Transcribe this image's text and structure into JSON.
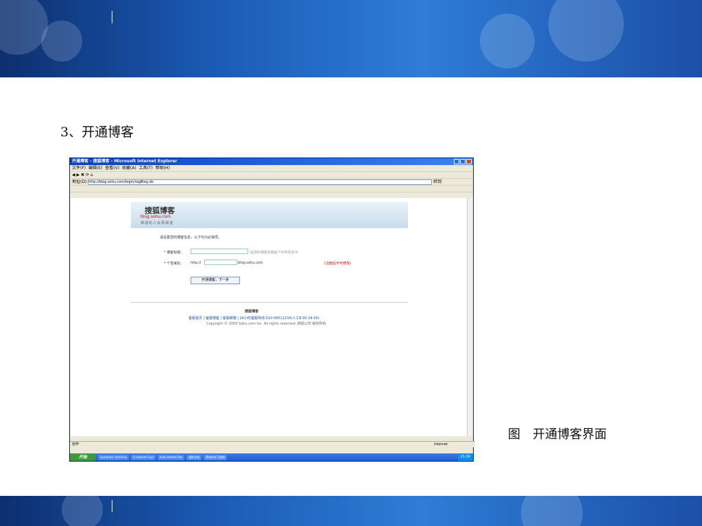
{
  "slide": {
    "title": "3、开通博客",
    "caption": "图　开通博客界面"
  },
  "ie": {
    "window_title": "开通博客 - 搜狐博客 - Microsoft Internet Explorer",
    "menu": [
      "文件(F)",
      "编辑(E)",
      "查看(V)",
      "收藏(A)",
      "工具(T)",
      "帮助(H)"
    ],
    "address_label": "地址(D)",
    "url": "http://blog.sohu.com/login/regBlog.do",
    "go": "转到",
    "logo": "搜狐博客",
    "logo_sub": "blog.sohu.com",
    "slogan": "相遇的人会再相遇",
    "intro": "请设置您的博客信息，以下均为必填项。",
    "field_title_label": "* 博客标题：",
    "field_title_hint": "给您的博客标题起个好听的名字",
    "field_domain_label": "* 个性域名：",
    "domain_prefix": "http://",
    "domain_suffix": "blog.sohu.com",
    "field_domain_warn": "(注册后不可修改)",
    "submit": "开通博客，下一步",
    "footer_logo": "搜狐博客",
    "footer_links": "客服首页 | 客服博客 | 客服邮箱 | 24小时客服热线:010-58511234(人工8:00-24:00)",
    "copyright": "Copyright © 2009 Sohu.com Inc. All rights reserved. 搜狐公司 版权所有",
    "status": "完毕",
    "zone": "Internet",
    "taskbar": {
      "start": "开始",
      "tasks": [
        "Symantec AntiVirus",
        "6 Internet Expl",
        "Auto-Protect Res",
        "我的文档",
        "简体的学习指南"
      ],
      "clock": "21:24"
    }
  }
}
